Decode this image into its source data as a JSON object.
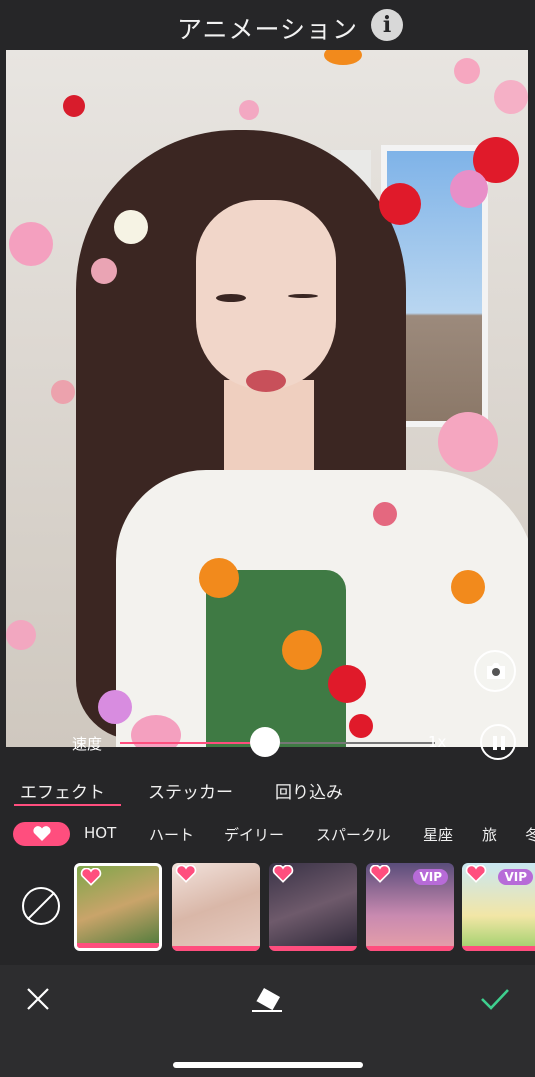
{
  "header": {
    "title": "アニメーション",
    "info_icon": "info-icon"
  },
  "preview": {
    "camera_icon": "camera-icon",
    "speed_label": "速度",
    "speed_value": "1x",
    "speed_fraction": 0.46,
    "pause_icon": "pause-icon"
  },
  "tabs": [
    {
      "label": "エフェクト",
      "selected": true
    },
    {
      "label": "ステッカー",
      "selected": false
    },
    {
      "label": "回り込み",
      "selected": false
    }
  ],
  "categories": {
    "favorites_icon": "heart-icon",
    "items": [
      "HOT",
      "ハート",
      "デイリー",
      "スパークル",
      "星座",
      "旅",
      "冬"
    ]
  },
  "effects": [
    {
      "icon": "heart-icon",
      "selected": true,
      "vip": ""
    },
    {
      "icon": "heart-icon",
      "selected": false,
      "vip": ""
    },
    {
      "icon": "heart-icon",
      "selected": false,
      "vip": ""
    },
    {
      "icon": "heart-icon",
      "selected": false,
      "vip": "VIP"
    },
    {
      "icon": "heart-icon",
      "selected": false,
      "vip": "VIP"
    }
  ],
  "toolbar": {
    "close_icon": "close-icon",
    "eraser_icon": "eraser-icon",
    "confirm_icon": "checkmark-icon"
  },
  "colors": {
    "accent": "#ff4e7e",
    "background": "#262628",
    "confirm": "#3ecf8e"
  }
}
